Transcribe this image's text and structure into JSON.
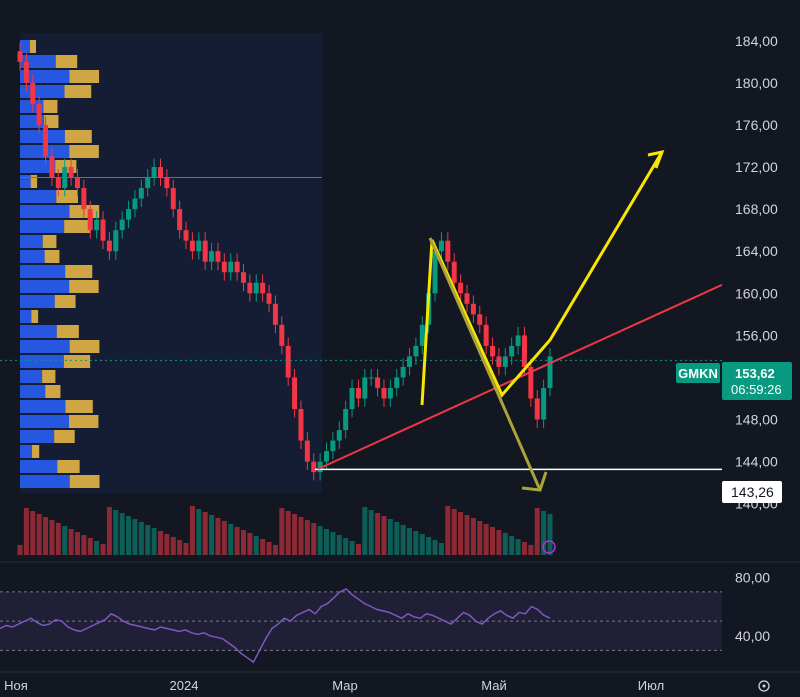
{
  "chart_data": [
    {
      "type": "candlestick",
      "symbol": "GMKN",
      "last_price": "153,62",
      "countdown": "06:59:26",
      "support_price": "143,26",
      "y_ticks": [
        "184,00",
        "180,00",
        "176,00",
        "172,00",
        "168,00",
        "164,00",
        "160,00",
        "156,00",
        "152,00",
        "148,00",
        "144,00",
        "140,00"
      ],
      "y_range": [
        137.5,
        185.5
      ],
      "x_labels": [
        "Ноя",
        "2024",
        "Мар",
        "Май",
        "Июл"
      ],
      "grid": false,
      "volume_profile_line": 171,
      "trendline": {
        "from": {
          "i": 0,
          "price": 143.3
        },
        "to": {
          "i": 1,
          "price": 160.8
        }
      },
      "closes": [
        182,
        180,
        178,
        176,
        173,
        171,
        170,
        172,
        171,
        170,
        168,
        166,
        167,
        165,
        164,
        166,
        167,
        168,
        169,
        170,
        171,
        172,
        171,
        170,
        168,
        166,
        165,
        164,
        165,
        163,
        164,
        163,
        162,
        163,
        162,
        161,
        160,
        161,
        160,
        159,
        157,
        155,
        152,
        149,
        146,
        144,
        143,
        144,
        145,
        146,
        147,
        149,
        151,
        150,
        152,
        152,
        151,
        150,
        151,
        152,
        153,
        154,
        155,
        157,
        160,
        164,
        165,
        163,
        161,
        160,
        159,
        158,
        157,
        155,
        154,
        153,
        154,
        155,
        156,
        153,
        150,
        148,
        151,
        154
      ]
    },
    {
      "type": "line",
      "indicator": "RSI",
      "y_ticks": [
        "80,00",
        "40,00"
      ],
      "y_range": [
        20,
        85
      ],
      "values": [
        45,
        47,
        46,
        48,
        50,
        52,
        49,
        47,
        48,
        51,
        50,
        46,
        44,
        43,
        45,
        47,
        49,
        51,
        55,
        53,
        50,
        48,
        47,
        46,
        45,
        44,
        46,
        45,
        44,
        43,
        44,
        42,
        41,
        42,
        40,
        39,
        38,
        35,
        32,
        28,
        25,
        22,
        30,
        38,
        45,
        48,
        52,
        50,
        54,
        56,
        58,
        55,
        60,
        62,
        66,
        70,
        72,
        68,
        65,
        62,
        60,
        58,
        57,
        56,
        54,
        52,
        55,
        53,
        52,
        55,
        54,
        52,
        50,
        48,
        52,
        56,
        54,
        50,
        48,
        52,
        55,
        57,
        54,
        52,
        56,
        55,
        60,
        58,
        54,
        52
      ]
    }
  ]
}
